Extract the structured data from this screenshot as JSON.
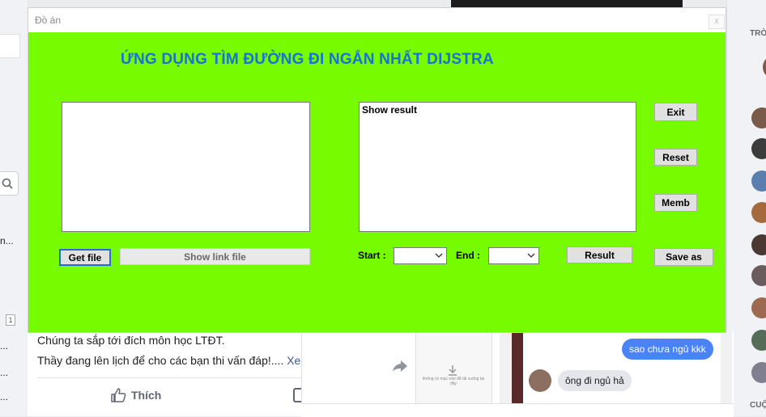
{
  "window": {
    "title": "Đồ án",
    "close_glyph": "x",
    "heading": "ỨNG DỤNG TÌM ĐƯỜNG ĐI NGẮN NHẤT DIJSTRA",
    "result_text": "Show result",
    "buttons": {
      "exit": "Exit",
      "reset": "Reset",
      "memb": "Memb",
      "get_file": "Get file",
      "show_link_file": "Show link file",
      "result": "Result",
      "save_as": "Save as"
    },
    "labels": {
      "start": "Start :",
      "end": "End :"
    },
    "start_value": "",
    "end_value": "",
    "colors": {
      "client_bg": "#76fb00",
      "heading": "#1773d8"
    }
  },
  "background": {
    "left_col": {
      "lines": [
        "n...",
        "...",
        "...",
        "..."
      ],
      "page_number": "1"
    },
    "right_col": {
      "label_top": "TRÒ",
      "label_bottom": "CUỘ"
    },
    "post": {
      "line1": "Chúng ta sắp tới đích môn học LTĐT.",
      "line2": "Thầy đang lên lịch để cho các bạn thi vấn đáp!.... ",
      "see_more": "Xe",
      "like": "Thích"
    },
    "chat": {
      "message_me": "sao chưa ngủ kkk",
      "message_them": "ông đi ngủ hả"
    },
    "thumb_caption": "không có mục nào để tải xuống tại đây"
  }
}
